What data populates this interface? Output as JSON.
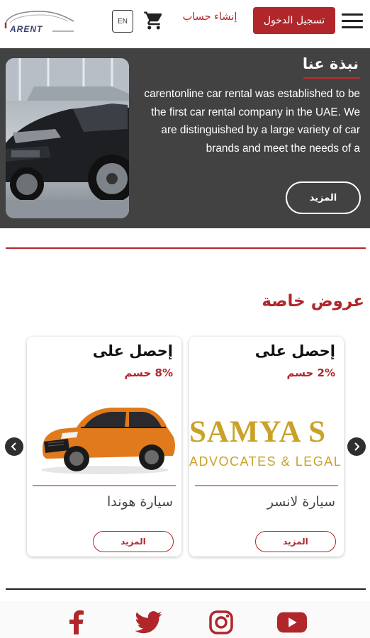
{
  "header": {
    "logo_text": "ARENT",
    "lang_label": "EN",
    "signup_label": "إنشاء حساب",
    "login_label": "تسجيل الدخول"
  },
  "about": {
    "title": "نبذة عنا",
    "text": "carentonline car rental was established to be the first car rental company in the UAE. We are distinguished by a large variety of car brands and meet the needs of a",
    "more_label": "المزيد"
  },
  "offers": {
    "title": "عروض خاصة",
    "cards": [
      {
        "heading": "إحصل على",
        "discount": "2% حسم",
        "image_text": "SAMYA S",
        "image_subtext": "ADVOCATES & LEGAL",
        "name": "سيارة لانسر",
        "more_label": "المزيد"
      },
      {
        "heading": "إحصل على",
        "discount": "8% حسم",
        "name": "سيارة هوندا",
        "more_label": "المزيد"
      }
    ]
  },
  "footer": {
    "social": [
      "facebook-icon",
      "twitter-icon",
      "instagram-icon",
      "youtube-icon"
    ]
  },
  "colors": {
    "brand_red": "#b0262b",
    "about_bg": "#424242",
    "samya_gold": "#c9a227"
  }
}
